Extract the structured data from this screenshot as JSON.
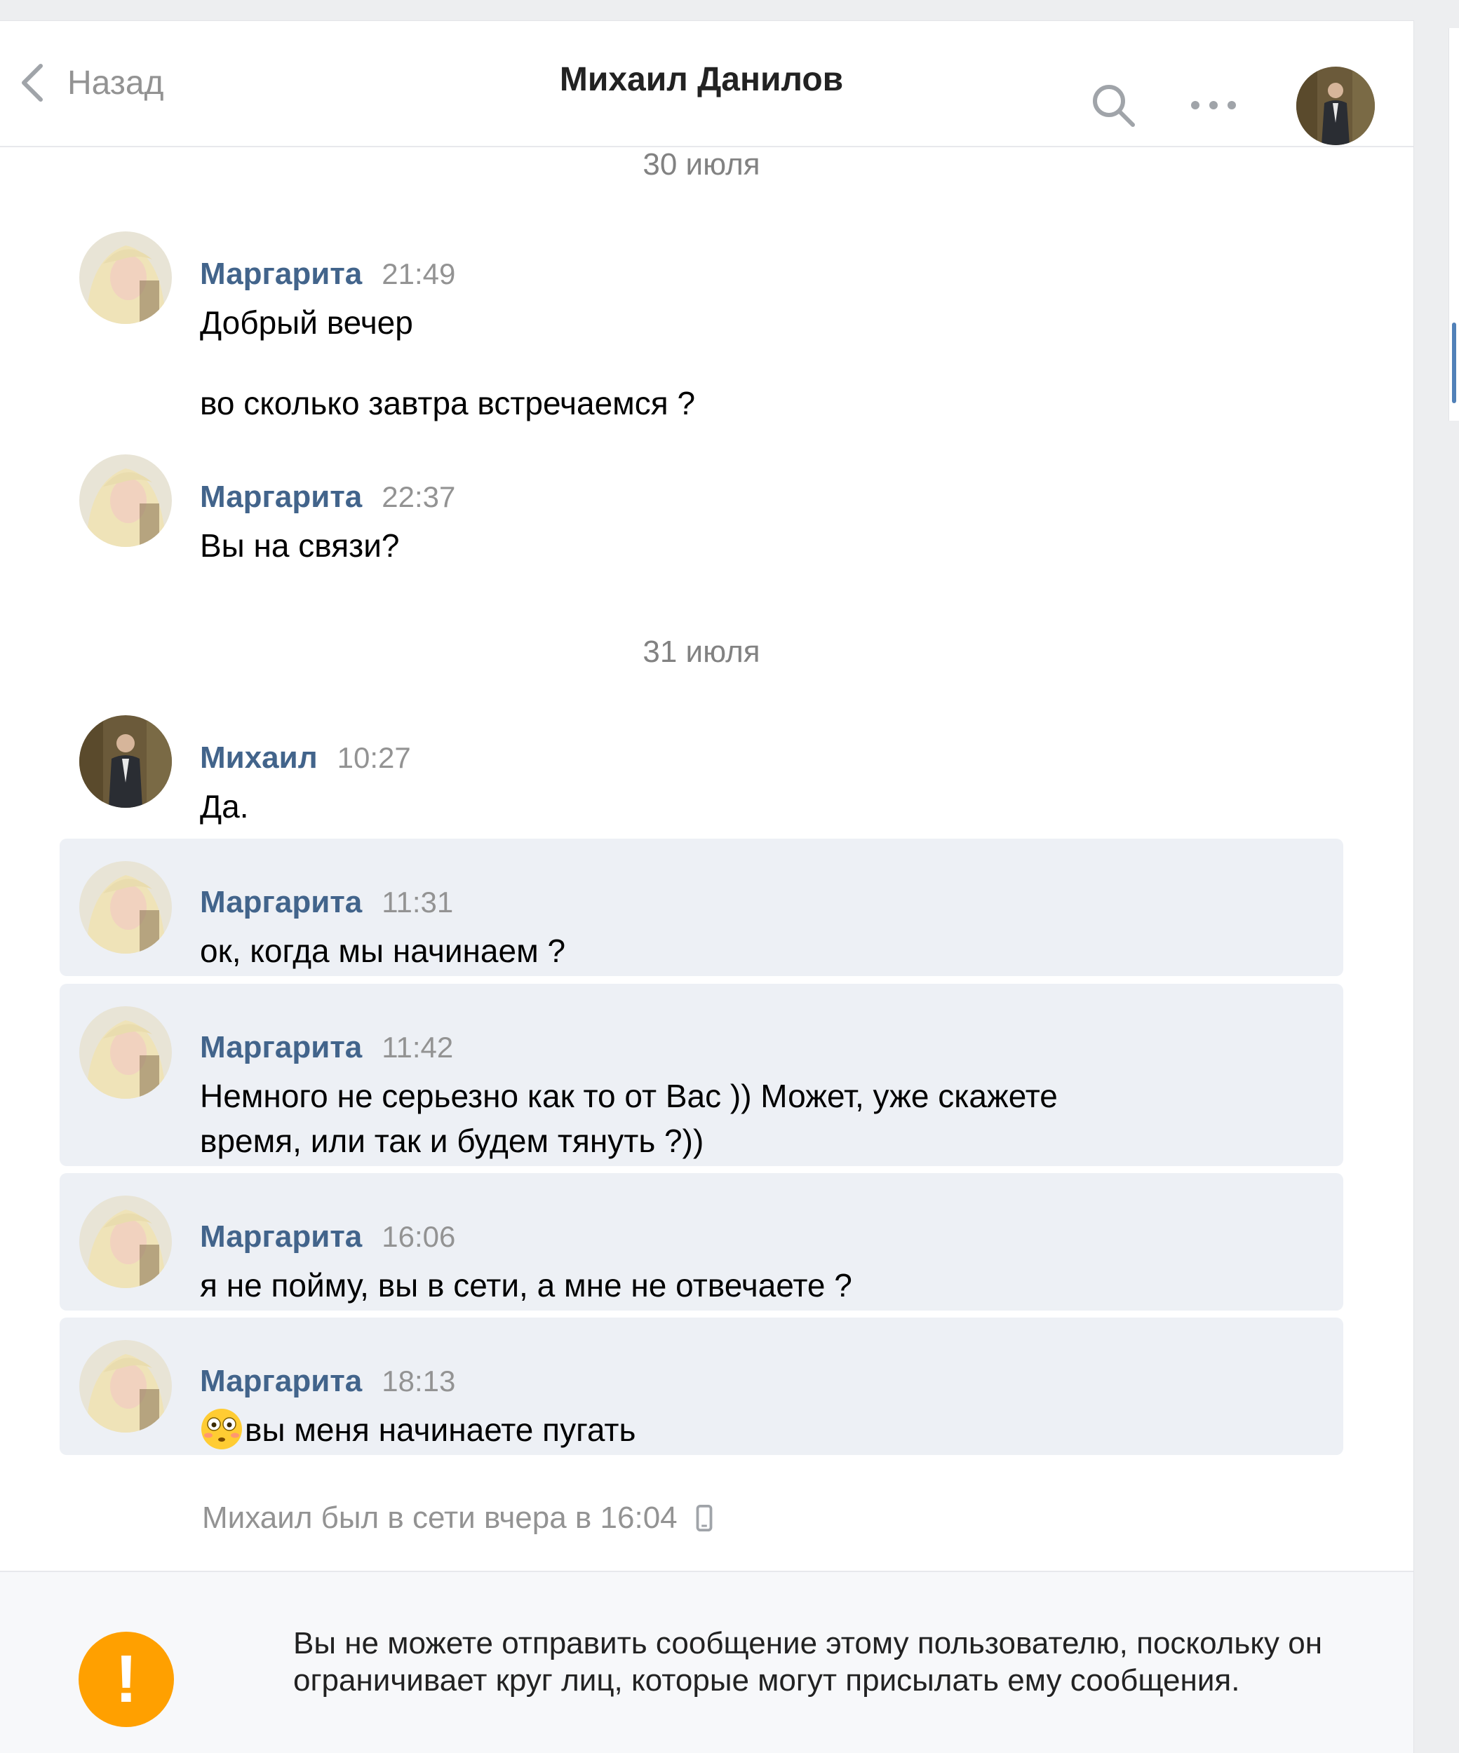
{
  "header": {
    "back_label": "Назад",
    "title": "Михаил Данилов"
  },
  "dates": {
    "first": "30 июля",
    "second": "31 июля"
  },
  "messages": [
    {
      "author": "Маргарита",
      "time": "21:49",
      "lines": [
        "Добрый вечер",
        "во сколько завтра встречаемся ?"
      ]
    },
    {
      "author": "Маргарита",
      "time": "22:37",
      "lines": [
        "Вы на связи?"
      ]
    },
    {
      "author": "Михаил",
      "time": "10:27",
      "lines": [
        "Да."
      ]
    },
    {
      "author": "Маргарита",
      "time": "11:31",
      "lines": [
        "ок, когда мы начинаем ?"
      ]
    },
    {
      "author": "Маргарита",
      "time": "11:42",
      "lines": [
        "Немного не серьезно как то от Вас )) Может, уже скажете",
        "время, или так и будем тянуть ?))"
      ]
    },
    {
      "author": "Маргарита",
      "time": "16:06",
      "lines": [
        "я не пойму, вы в сети, а мне не отвечаете ?"
      ]
    },
    {
      "author": "Маргарита",
      "time": "18:13",
      "lines": [
        "вы меня начинаете пугать"
      ]
    }
  ],
  "status": {
    "last_seen": "Михаил был в сети вчера в 16:04"
  },
  "footer": {
    "warning_icon": "!",
    "warning_text": "Вы не можете отправить сообщение этому пользователю, поскольку он ограничивает круг лиц, которые могут присылать ему сообщения."
  },
  "colors": {
    "author": "#42648b",
    "unread_bg": "#edf0f5",
    "warning": "#ffa000"
  }
}
